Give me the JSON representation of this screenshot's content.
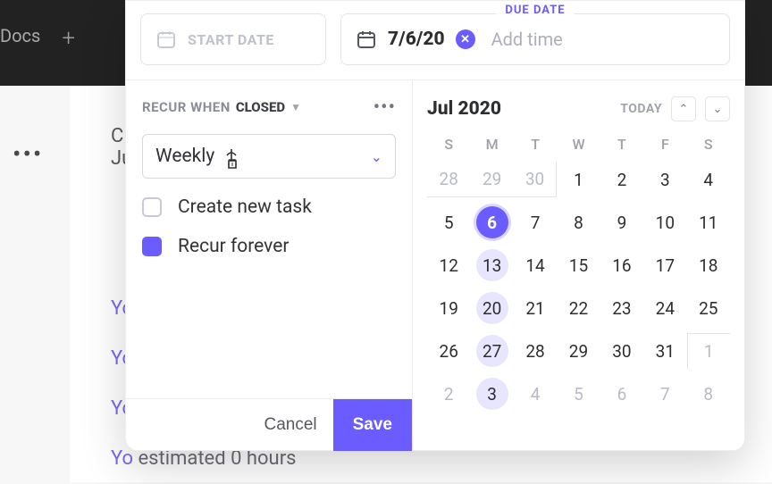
{
  "colors": {
    "accent": "#6a5cff"
  },
  "topbar": {
    "docs": "Docs"
  },
  "page": {
    "partial1": "C",
    "partial2": "Ju",
    "links": [
      "Yo",
      "Yo",
      "Yo",
      "Yo"
    ],
    "estimated_trail": " estimated 0 hours"
  },
  "popup": {
    "start_placeholder": "START DATE",
    "due_label": "DUE DATE",
    "due_value": "7/6/20",
    "add_time": "Add time",
    "recur_label": "RECUR WHEN",
    "recur_status": "CLOSED",
    "frequency": "Weekly",
    "opt_create_new": "Create new task",
    "opt_forever": "Recur forever",
    "cancel": "Cancel",
    "save": "Save"
  },
  "calendar": {
    "month": "Jul 2020",
    "today": "TODAY",
    "dow": [
      "S",
      "M",
      "T",
      "W",
      "T",
      "F",
      "S"
    ],
    "weeks": [
      [
        {
          "d": "28",
          "out": true
        },
        {
          "d": "29",
          "out": true
        },
        {
          "d": "30",
          "out": true
        },
        {
          "d": "1"
        },
        {
          "d": "2"
        },
        {
          "d": "3"
        },
        {
          "d": "4"
        }
      ],
      [
        {
          "d": "5"
        },
        {
          "d": "6",
          "selected": true
        },
        {
          "d": "7"
        },
        {
          "d": "8"
        },
        {
          "d": "9"
        },
        {
          "d": "10"
        },
        {
          "d": "11"
        }
      ],
      [
        {
          "d": "12"
        },
        {
          "d": "13",
          "high": true
        },
        {
          "d": "14"
        },
        {
          "d": "15"
        },
        {
          "d": "16"
        },
        {
          "d": "17"
        },
        {
          "d": "18"
        }
      ],
      [
        {
          "d": "19"
        },
        {
          "d": "20",
          "high": true
        },
        {
          "d": "21"
        },
        {
          "d": "22"
        },
        {
          "d": "23"
        },
        {
          "d": "24"
        },
        {
          "d": "25"
        }
      ],
      [
        {
          "d": "26"
        },
        {
          "d": "27",
          "high": true
        },
        {
          "d": "28"
        },
        {
          "d": "29"
        },
        {
          "d": "30"
        },
        {
          "d": "31"
        },
        {
          "d": "1",
          "out": true
        }
      ],
      [
        {
          "d": "2",
          "out": true
        },
        {
          "d": "3",
          "out": true,
          "high": true
        },
        {
          "d": "4",
          "out": true
        },
        {
          "d": "5",
          "out": true
        },
        {
          "d": "6",
          "out": true
        },
        {
          "d": "7",
          "out": true
        },
        {
          "d": "8",
          "out": true
        }
      ]
    ]
  }
}
